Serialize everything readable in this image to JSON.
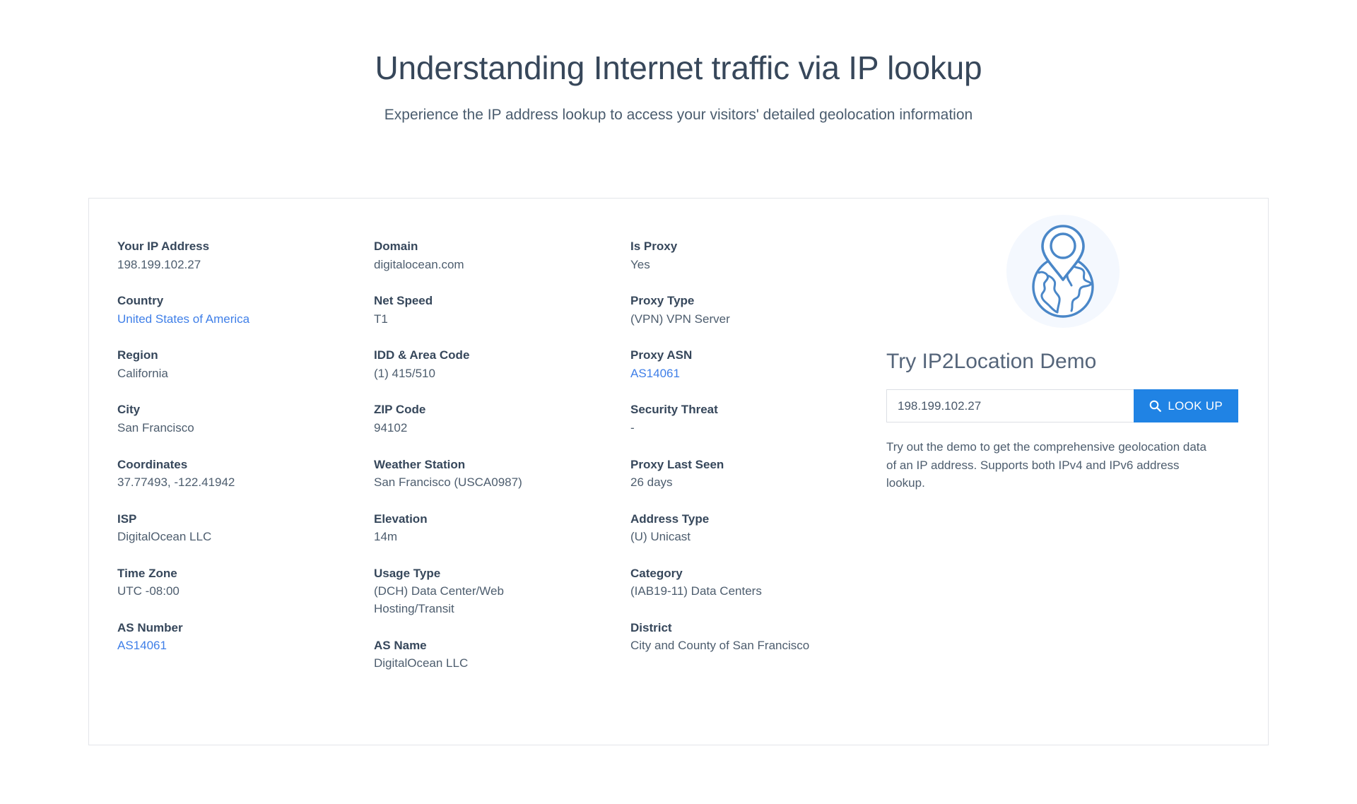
{
  "hero": {
    "title": "Understanding Internet traffic via IP lookup",
    "subtitle": "Experience the IP address lookup to access your visitors' detailed geolocation information"
  },
  "colors": {
    "accent": "#2083e4",
    "link": "#3f7fe8",
    "heading": "#37475a",
    "label": "#36475b",
    "value": "#4d5d6e",
    "card_border": "#e3e5ea",
    "icon_bg": "#f4f8fe",
    "icon_stroke": "#4a87c8"
  },
  "columns": [
    {
      "name": "column-1",
      "fields": [
        {
          "label": "Your IP Address",
          "value": "198.199.102.27",
          "is_link": false
        },
        {
          "label": "Country",
          "value": "United States of America",
          "is_link": true
        },
        {
          "label": "Region",
          "value": "California",
          "is_link": false
        },
        {
          "label": "City",
          "value": "San Francisco",
          "is_link": false
        },
        {
          "label": "Coordinates",
          "value": "37.77493, -122.41942",
          "is_link": false
        },
        {
          "label": "ISP",
          "value": "DigitalOcean LLC",
          "is_link": false
        },
        {
          "label": "Time Zone",
          "value": "UTC -08:00",
          "is_link": false
        },
        {
          "label": "AS Number",
          "value": "AS14061",
          "is_link": true
        }
      ]
    },
    {
      "name": "column-2",
      "fields": [
        {
          "label": "Domain",
          "value": "digitalocean.com",
          "is_link": false
        },
        {
          "label": "Net Speed",
          "value": "T1",
          "is_link": false
        },
        {
          "label": "IDD & Area Code",
          "value": "(1) 415/510",
          "is_link": false
        },
        {
          "label": "ZIP Code",
          "value": "94102",
          "is_link": false
        },
        {
          "label": "Weather Station",
          "value": "San Francisco (USCA0987)",
          "is_link": false
        },
        {
          "label": "Elevation",
          "value": "14m",
          "is_link": false
        },
        {
          "label": "Usage Type",
          "value": "(DCH) Data Center/Web Hosting/Transit",
          "is_link": false
        },
        {
          "label": "AS Name",
          "value": "DigitalOcean LLC",
          "is_link": false
        }
      ]
    },
    {
      "name": "column-3",
      "fields": [
        {
          "label": "Is Proxy",
          "value": "Yes",
          "is_link": false
        },
        {
          "label": "Proxy Type",
          "value": "(VPN) VPN Server",
          "is_link": false
        },
        {
          "label": "Proxy ASN",
          "value": "AS14061",
          "is_link": true
        },
        {
          "label": "Security Threat",
          "value": "-",
          "is_link": false
        },
        {
          "label": "Proxy Last Seen",
          "value": "26 days",
          "is_link": false
        },
        {
          "label": "Address Type",
          "value": "(U) Unicast",
          "is_link": false
        },
        {
          "label": "Category",
          "value": "(IAB19-11) Data Centers",
          "is_link": false
        },
        {
          "label": "District",
          "value": "City and County of San Francisco",
          "is_link": false
        }
      ]
    }
  ],
  "promo": {
    "icon_name": "globe-location-pin-icon",
    "title": "Try IP2Location Demo",
    "input_value": "198.199.102.27",
    "input_placeholder": "Enter IP address",
    "button_label": "LOOK UP",
    "button_icon": "search-icon",
    "description": "Try out the demo to get the comprehensive geolocation data of an IP address. Supports both IPv4 and IPv6 address lookup."
  }
}
